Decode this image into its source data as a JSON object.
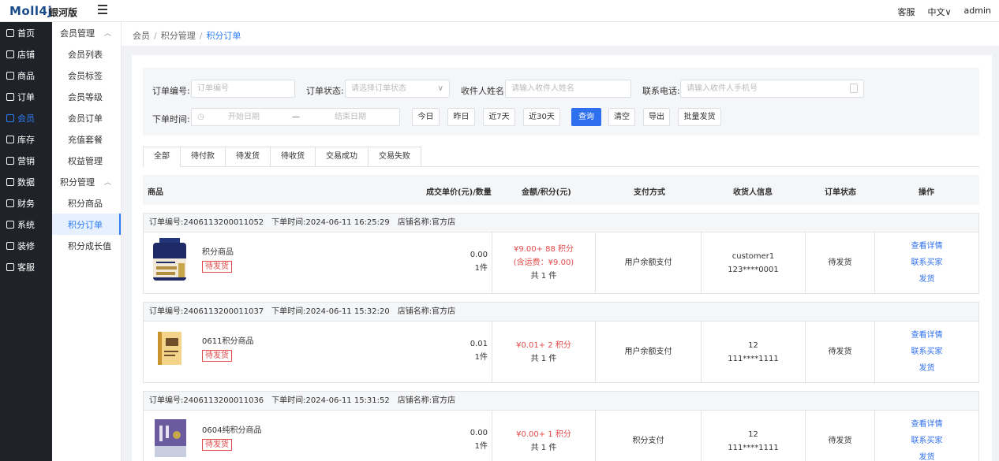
{
  "brand": {
    "logo": "Moll4j",
    "edition": "银河版"
  },
  "topright": {
    "service": "客服",
    "lang": "中文∨",
    "user": "admin"
  },
  "sidebar": [
    {
      "label": "首页",
      "icon": "home-icon"
    },
    {
      "label": "店铺",
      "icon": "shop-icon"
    },
    {
      "label": "商品",
      "icon": "goods-icon"
    },
    {
      "label": "订单",
      "icon": "order-icon"
    },
    {
      "label": "会员",
      "icon": "member-icon",
      "active": true
    },
    {
      "label": "库存",
      "icon": "stock-icon"
    },
    {
      "label": "营销",
      "icon": "gift-icon"
    },
    {
      "label": "数据",
      "icon": "chart-icon"
    },
    {
      "label": "财务",
      "icon": "finance-icon"
    },
    {
      "label": "系统",
      "icon": "gear-icon"
    },
    {
      "label": "装修",
      "icon": "decor-icon"
    },
    {
      "label": "客服",
      "icon": "chat-icon"
    }
  ],
  "submenu": {
    "group1": "会员管理",
    "items1": [
      "会员列表",
      "会员标签",
      "会员等级",
      "会员订单",
      "充值套餐",
      "权益管理"
    ],
    "group2": "积分管理",
    "items2": [
      "积分商品",
      "积分订单",
      "积分成长值"
    ]
  },
  "breadcrumb": {
    "a": "会员",
    "b": "积分管理",
    "c": "积分订单",
    "sep": "/"
  },
  "filter": {
    "order_no_label": "订单编号:",
    "order_no_ph": "订单编号",
    "status_label": "订单状态:",
    "status_ph": "请选择订单状态",
    "receiver_label": "收件人姓名:",
    "receiver_ph": "请输入收件人姓名",
    "phone_label": "联系电话:",
    "phone_ph": "请输入收件人手机号",
    "time_label": "下单时间:",
    "start_ph": "开始日期",
    "dash": "—",
    "end_ph": "结束日期",
    "today": "今日",
    "yesterday": "昨日",
    "d7": "近7天",
    "d30": "近30天",
    "query": "查询",
    "clear": "清空",
    "export": "导出",
    "batch": "批量发货"
  },
  "tabs": [
    "全部",
    "待付款",
    "待发货",
    "待收货",
    "交易成功",
    "交易失败"
  ],
  "thead": {
    "goods": "商品",
    "unit": "成交单价(元)/数量",
    "amount": "金额/积分(元)",
    "pay": "支付方式",
    "receiver": "收货人信息",
    "status": "订单状态",
    "ops": "操作"
  },
  "labels": {
    "order_no": "订单编号:",
    "order_time": "下单时间:",
    "shop": "店铺名称:"
  },
  "ops": {
    "detail": "查看详情",
    "contact": "联系买家",
    "ship": "发货"
  },
  "orders": [
    {
      "no": "2406113200011052",
      "time": "2024-06-11 16:25:29",
      "shop": "官方店",
      "name": "积分商品",
      "tag": "待发货",
      "price": "0.00",
      "qty": "1件",
      "amount": "¥9.00+ 88 积分",
      "freight": "(含运费：¥9.00)",
      "count": "共 1 件",
      "pay": "用户余额支付",
      "rname": "customer1",
      "rphone": "123****0001",
      "status": "待发货"
    },
    {
      "no": "2406113200011037",
      "time": "2024-06-11 15:32:20",
      "shop": "官方店",
      "name": "0611积分商品",
      "tag": "待发货",
      "price": "0.01",
      "qty": "1件",
      "amount": "¥0.01+ 2 积分",
      "freight": "",
      "count": "共 1 件",
      "pay": "用户余额支付",
      "rname": "12",
      "rphone": "111****1111",
      "status": "待发货"
    },
    {
      "no": "2406113200011036",
      "time": "2024-06-11 15:31:52",
      "shop": "官方店",
      "name": "0604纯积分商品",
      "tag": "待发货",
      "price": "0.00",
      "qty": "1件",
      "amount": "¥0.00+ 1 积分",
      "freight": "",
      "count": "共 1 件",
      "pay": "积分支付",
      "rname": "12",
      "rphone": "111****1111",
      "status": "待发货"
    }
  ]
}
